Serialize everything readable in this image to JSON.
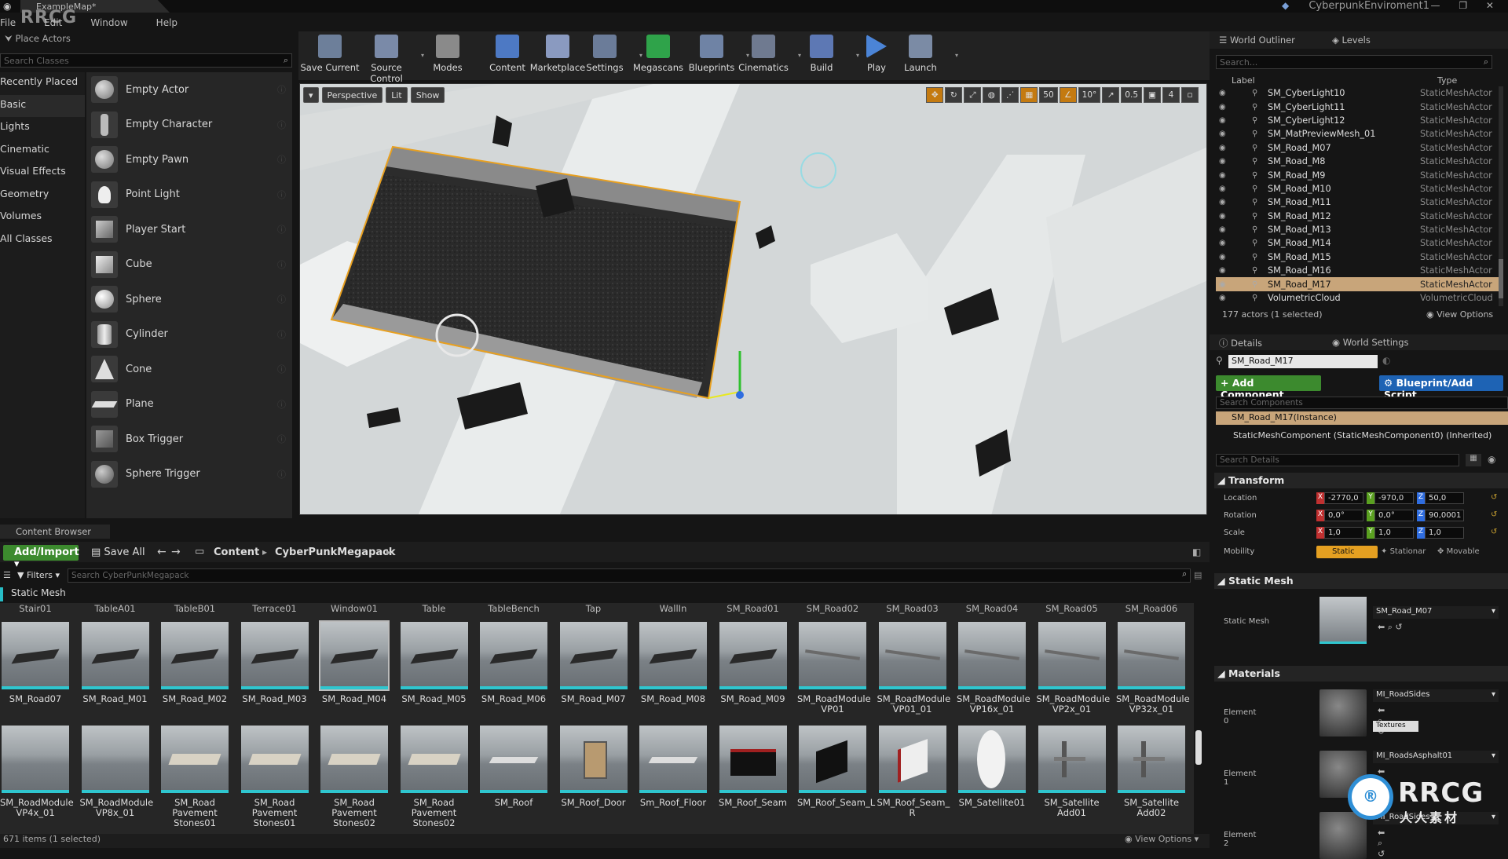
{
  "window": {
    "tab_title": "ExampleMap*",
    "project": "CyberpunkEnviroment1",
    "logo_text": "RRCG",
    "controls": "— ❐ ✕"
  },
  "menu": [
    "File",
    "Edit",
    "Window",
    "Help"
  ],
  "place_actors": {
    "tab": "Place Actors",
    "search_placeholder": "Search Classes",
    "categories": [
      "Recently Placed",
      "Basic",
      "Lights",
      "Cinematic",
      "Visual Effects",
      "Geometry",
      "Volumes",
      "All Classes"
    ],
    "actors": [
      {
        "label": "Empty Actor",
        "icon": "sphere-dark-icon"
      },
      {
        "label": "Empty Character",
        "icon": "character-icon"
      },
      {
        "label": "Empty Pawn",
        "icon": "sphere-dark-icon"
      },
      {
        "label": "Point Light",
        "icon": "bulb-icon"
      },
      {
        "label": "Player Start",
        "icon": "player-start-icon"
      },
      {
        "label": "Cube",
        "icon": "cube-icon"
      },
      {
        "label": "Sphere",
        "icon": "sphere-icon"
      },
      {
        "label": "Cylinder",
        "icon": "cylinder-icon"
      },
      {
        "label": "Cone",
        "icon": "cone-icon"
      },
      {
        "label": "Plane",
        "icon": "plane-icon"
      },
      {
        "label": "Box Trigger",
        "icon": "box-trigger-icon"
      },
      {
        "label": "Sphere Trigger",
        "icon": "sphere-trigger-icon"
      }
    ]
  },
  "toolbar": [
    {
      "label": "Save Current",
      "color": "#6d7f9a",
      "dropdown": false
    },
    {
      "label": "Source Control",
      "color": "#7a8aa8",
      "dropdown": true
    },
    {
      "label": "Modes",
      "color": "#8a8a8a",
      "dropdown": false
    },
    {
      "label": "Content",
      "color": "#4d79c4",
      "dropdown": false
    },
    {
      "label": "Marketplace",
      "color": "#8a9ac0",
      "dropdown": false
    },
    {
      "label": "Settings",
      "color": "#6b7c99",
      "dropdown": true
    },
    {
      "label": "Megascans",
      "color": "#2fa34a",
      "dropdown": false
    },
    {
      "label": "Blueprints",
      "color": "#6f83a5",
      "dropdown": true
    },
    {
      "label": "Cinematics",
      "color": "#6f7a90",
      "dropdown": true
    },
    {
      "label": "Build",
      "color": "#5d78b4",
      "dropdown": true
    },
    {
      "label": "Play",
      "color": "#4b84d6",
      "dropdown": true
    },
    {
      "label": "Launch",
      "color": "#7b8ba5",
      "dropdown": true
    }
  ],
  "viewport": {
    "perspective": "Perspective",
    "lit": "Lit",
    "show": "Show",
    "grid_snap": "50",
    "rot_snap": "10°",
    "scale_snap": "0.5",
    "cam_speed": "4"
  },
  "outliner": {
    "tabs": [
      "World Outliner",
      "Levels"
    ],
    "search_placeholder": "Search...",
    "col_label": "Label",
    "col_type": "Type",
    "rows": [
      {
        "label": "SM_CyberLight10",
        "type": "StaticMeshActor"
      },
      {
        "label": "SM_CyberLight11",
        "type": "StaticMeshActor"
      },
      {
        "label": "SM_CyberLight12",
        "type": "StaticMeshActor"
      },
      {
        "label": "SM_MatPreviewMesh_01",
        "type": "StaticMeshActor"
      },
      {
        "label": "SM_Road_M07",
        "type": "StaticMeshActor"
      },
      {
        "label": "SM_Road_M8",
        "type": "StaticMeshActor"
      },
      {
        "label": "SM_Road_M9",
        "type": "StaticMeshActor"
      },
      {
        "label": "SM_Road_M10",
        "type": "StaticMeshActor"
      },
      {
        "label": "SM_Road_M11",
        "type": "StaticMeshActor"
      },
      {
        "label": "SM_Road_M12",
        "type": "StaticMeshActor"
      },
      {
        "label": "SM_Road_M13",
        "type": "StaticMeshActor"
      },
      {
        "label": "SM_Road_M14",
        "type": "StaticMeshActor"
      },
      {
        "label": "SM_Road_M15",
        "type": "StaticMeshActor"
      },
      {
        "label": "SM_Road_M16",
        "type": "StaticMeshActor"
      },
      {
        "label": "SM_Road_M17",
        "type": "StaticMeshActor"
      },
      {
        "label": "VolumetricCloud",
        "type": "VolumetricCloud"
      }
    ],
    "selected": "SM_Road_M17",
    "footer": "177 actors (1 selected)",
    "view_options": "View Options"
  },
  "details": {
    "tabs": [
      "Details",
      "World Settings"
    ],
    "name": "SM_Road_M17",
    "add_component": "+ Add Component",
    "blueprint": "Blueprint/Add Script",
    "search_components": "Search Components",
    "instance": "SM_Road_M17(Instance)",
    "component": "StaticMeshComponent (StaticMeshComponent0) (Inherited)",
    "search_details": "Search Details",
    "transform": "Transform",
    "location_label": "Location",
    "rotation_label": "Rotation",
    "scale_label": "Scale",
    "mobility_label": "Mobility",
    "location": [
      "-2770,0",
      "-970,0",
      "50,0"
    ],
    "rotation": [
      "0,0°",
      "0,0°",
      "90,0001"
    ],
    "scale": [
      "1,0",
      "1,0",
      "1,0"
    ],
    "mobility": [
      "Static",
      "Stationar",
      "Movable"
    ],
    "static_mesh_section": "Static Mesh",
    "static_mesh_label": "Static Mesh",
    "static_mesh_value": "SM_Road_M07",
    "materials_section": "Materials",
    "elements": [
      {
        "label": "Element 0",
        "material": "MI_RoadSides",
        "extra": "Textures"
      },
      {
        "label": "Element 1",
        "material": "MI_RoadsAsphalt01",
        "extra": ""
      },
      {
        "label": "Element 2",
        "material": "MI_RoadSides",
        "extra": ""
      }
    ],
    "watermark": "RRCG",
    "watermark_sub": "人人素材"
  },
  "content_browser": {
    "tab": "Content Browser",
    "add_import": "Add/Import",
    "save_all": "Save All",
    "path": [
      "Content",
      "CyberPunkMegapack"
    ],
    "filters": "Filters",
    "search_placeholder": "Search CyberPunkMegapack",
    "filter_chip": "Static Mesh",
    "top_labels": [
      "Stair01",
      "TableA01",
      "TableB01",
      "Terrace01",
      "Window01",
      "Table",
      "TableBench",
      "Tap",
      "WallIn",
      "SM_Road01",
      "SM_Road02",
      "SM_Road03",
      "SM_Road04",
      "SM_Road05",
      "SM_Road06"
    ],
    "row1": [
      "SM_Road07",
      "SM_Road_M01",
      "SM_Road_M02",
      "SM_Road_M03",
      "SM_Road_M04",
      "SM_Road_M05",
      "SM_Road_M06",
      "SM_Road_M07",
      "SM_Road_M08",
      "SM_Road_M09",
      "SM_RoadModule VP01",
      "SM_RoadModule VP01_01",
      "SM_RoadModule VP16x_01",
      "SM_RoadModule VP2x_01",
      "SM_RoadModule VP32x_01"
    ],
    "row2": [
      "SM_RoadModule VP4x_01",
      "SM_RoadModule VP8x_01",
      "SM_Road Pavement Stones01",
      "SM_Road Pavement Stones01",
      "SM_Road Pavement Stones02",
      "SM_Road Pavement Stones02",
      "SM_Roof",
      "SM_Roof_Door",
      "Sm_Roof_Floor",
      "SM_Roof_Seam",
      "SM_Roof_Seam_L",
      "SM_Roof_Seam_ R",
      "SM_Satellite01",
      "SM_Satellite Add01",
      "SM_Satellite Add02"
    ],
    "status": "671 items (1 selected)",
    "view_options": "View Options"
  }
}
